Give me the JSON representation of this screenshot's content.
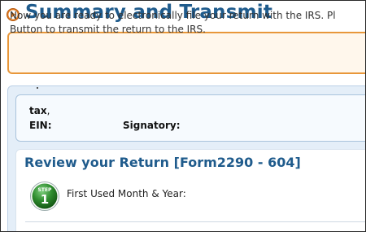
{
  "header": {
    "title": "Summary and Transmit",
    "icon": "play-circle-icon"
  },
  "notice": {
    "line1": "Now you are ready to electronically file your return with the IRS. Pl",
    "line2": "Button to transmit the return to the IRS."
  },
  "taxpayer": {
    "tax_label": "tax",
    "tax_suffix": ",",
    "ein_label": "EIN:",
    "signatory_label": "Signatory:"
  },
  "review": {
    "title": "Review your Return [Form2290 - 604]",
    "step_word": "STEP",
    "step_number": "1",
    "step_label": "First Used Month & Year:"
  },
  "colors": {
    "title_blue": "#1f5b8c",
    "notice_border": "#e8973a",
    "notice_bg": "#fff7ec",
    "panel_bg": "#e4eef8",
    "step_green": "#2e8b2e"
  }
}
